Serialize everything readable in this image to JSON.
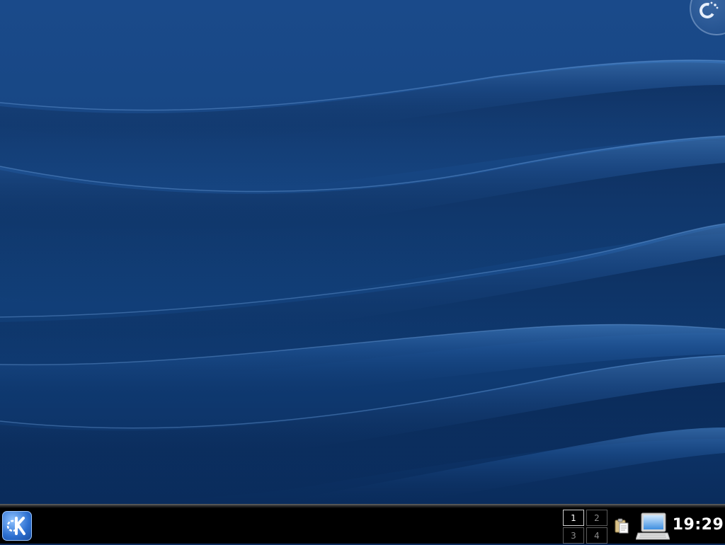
{
  "desktop": {
    "wallpaper_colors": {
      "base": "#12407a",
      "highlight": "#4f8fd6",
      "shadow": "#0a2a57"
    },
    "cashew_icon": "plasma-cashew-icon"
  },
  "panel": {
    "launcher_icon": "kde-k-menu-icon",
    "pager": {
      "desktops": [
        "1",
        "2",
        "3",
        "4"
      ],
      "active": "1"
    },
    "tray": {
      "clipboard_icon": "klipper-clipboard-icon",
      "computer_icon": "laptop-computer-icon"
    },
    "clock": {
      "time": "19:29"
    }
  }
}
